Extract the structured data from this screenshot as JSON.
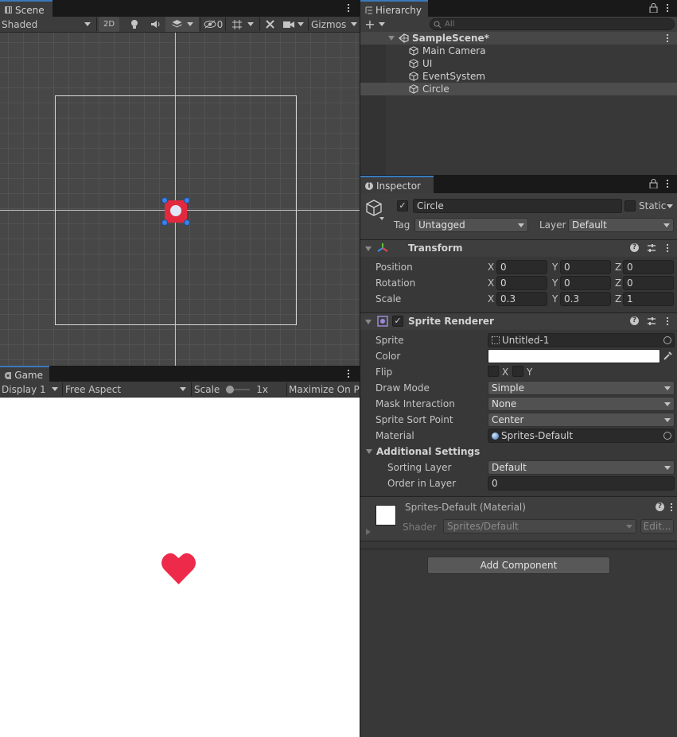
{
  "scene": {
    "tab_label": "Scene",
    "shading_mode": "Shaded",
    "btn_2d": "2D",
    "hidden_count": "0",
    "gizmos_label": "Gizmos"
  },
  "game": {
    "tab_label": "Game",
    "display": "Display 1",
    "aspect": "Free Aspect",
    "scale_label": "Scale",
    "scale_value": "1x",
    "maximize_label": "Maximize On Pl",
    "heart_color": "#ee2a4a"
  },
  "hierarchy": {
    "tab_label": "Hierarchy",
    "search_placeholder": "All",
    "scene_name": "SampleScene*",
    "items": [
      {
        "label": "Main Camera"
      },
      {
        "label": "UI"
      },
      {
        "label": "EventSystem"
      },
      {
        "label": "Circle"
      }
    ],
    "selected_item": "Circle"
  },
  "inspector": {
    "tab_label": "Inspector",
    "object_name": "Circle",
    "static_label": "Static",
    "tag_label": "Tag",
    "tag_value": "Untagged",
    "layer_label": "Layer",
    "layer_value": "Default",
    "transform": {
      "title": "Transform",
      "position_label": "Position",
      "rotation_label": "Rotation",
      "scale_label": "Scale",
      "position": {
        "x": "0",
        "y": "0",
        "z": "0"
      },
      "rotation": {
        "x": "0",
        "y": "0",
        "z": "0"
      },
      "scale": {
        "x": "0.3",
        "y": "0.3",
        "z": "1"
      }
    },
    "sprite_renderer": {
      "title": "Sprite Renderer",
      "sprite_label": "Sprite",
      "sprite_value": "Untitled-1",
      "color_label": "Color",
      "color_value": "#ffffff",
      "flip_label": "Flip",
      "flip_x": "X",
      "flip_y": "Y",
      "draw_mode_label": "Draw Mode",
      "draw_mode": "Simple",
      "mask_label": "Mask Interaction",
      "mask_value": "None",
      "sort_point_label": "Sprite Sort Point",
      "sort_point_value": "Center",
      "material_label": "Material",
      "material_value": "Sprites-Default",
      "additional_label": "Additional Settings",
      "sorting_layer_label": "Sorting Layer",
      "sorting_layer_value": "Default",
      "order_label": "Order in Layer",
      "order_value": "0"
    },
    "material": {
      "title": "Sprites-Default (Material)",
      "shader_label": "Shader",
      "shader_value": "Sprites/Default",
      "edit_label": "Edit..."
    },
    "add_component_label": "Add Component"
  },
  "axis_labels": {
    "x": "X",
    "y": "Y",
    "z": "Z"
  }
}
